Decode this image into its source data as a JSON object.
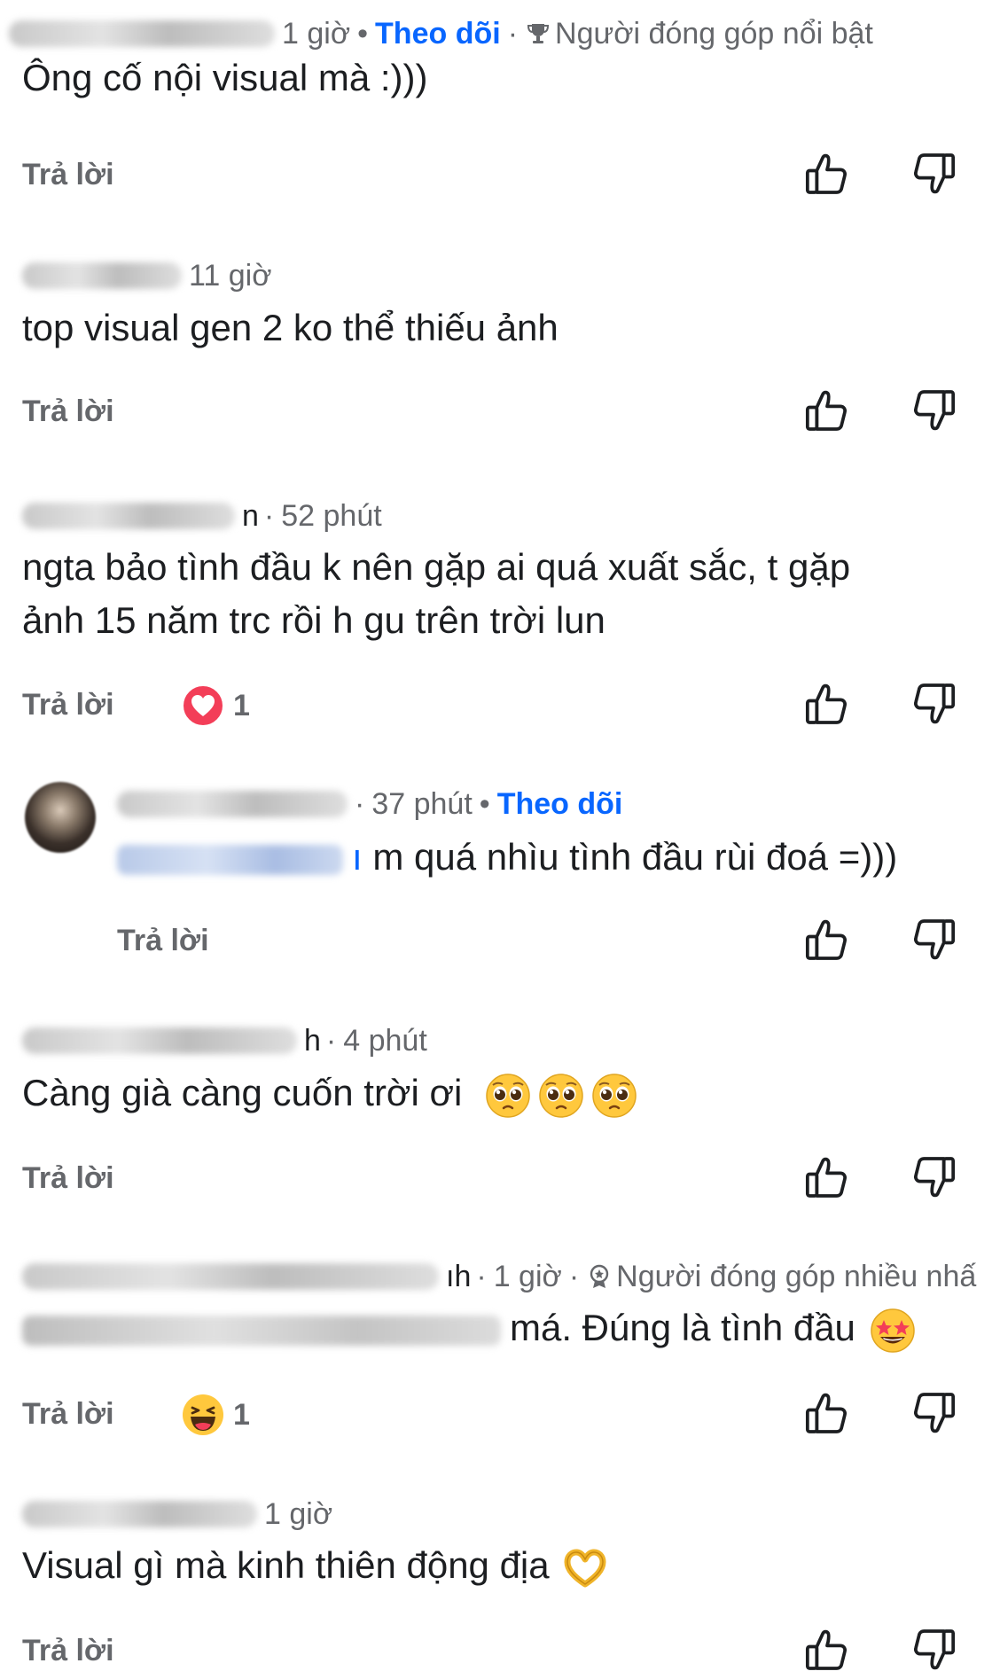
{
  "comments": [
    {
      "time": "1 giờ",
      "follow_label": "Theo dõi",
      "badge_label": "Người đóng góp nổi bật",
      "text": "Ông cố nội visual mà :)))",
      "reply_label": "Trả lời"
    },
    {
      "time": "11 giờ",
      "text": "top visual gen 2 ko thể thiếu ảnh",
      "reply_label": "Trả lời"
    },
    {
      "name_tail": "n",
      "time": "52 phút",
      "text_line1": "ngta bảo tình đầu k nên gặp ai quá xuất sắc, t gặp",
      "text_line2": "ảnh  15 năm trc rồi h gu trên trời lun",
      "reply_label": "Trả lời",
      "reaction_icon": "heart-reaction-icon",
      "reaction_count": "1"
    },
    {
      "time": "37 phút",
      "follow_label": "Theo dõi",
      "mention_tail": "ı",
      "text": "m quá nhìu tình đầu rùi đoá =)))",
      "reply_label": "Trả lời"
    },
    {
      "name_tail": "h",
      "time": "4 phút",
      "text": "Càng già càng cuốn trời ơi",
      "emojis": [
        "pleading-face-icon",
        "pleading-face-icon",
        "pleading-face-icon"
      ],
      "reply_label": "Trả lời"
    },
    {
      "name_tail": "ıh",
      "time": "1 giờ",
      "badge_label": "Người đóng góp nhiều nhấ",
      "text": "má. Đúng là tình đầu",
      "emojis": [
        "star-struck-icon"
      ],
      "reply_label": "Trả lời",
      "reaction_icon": "haha-reaction-icon",
      "reaction_count": "1"
    },
    {
      "time": "1 giờ",
      "text": "Visual gì mà kinh thiên động địa",
      "emojis": [
        "heart-hands-icon"
      ],
      "reply_label": "Trả lời"
    }
  ],
  "colors": {
    "follow": "#0866ff",
    "meta": "#65676b",
    "text": "#1c1e21",
    "heart": "#f33e58",
    "emoji_yellow": "#ffc83d"
  }
}
